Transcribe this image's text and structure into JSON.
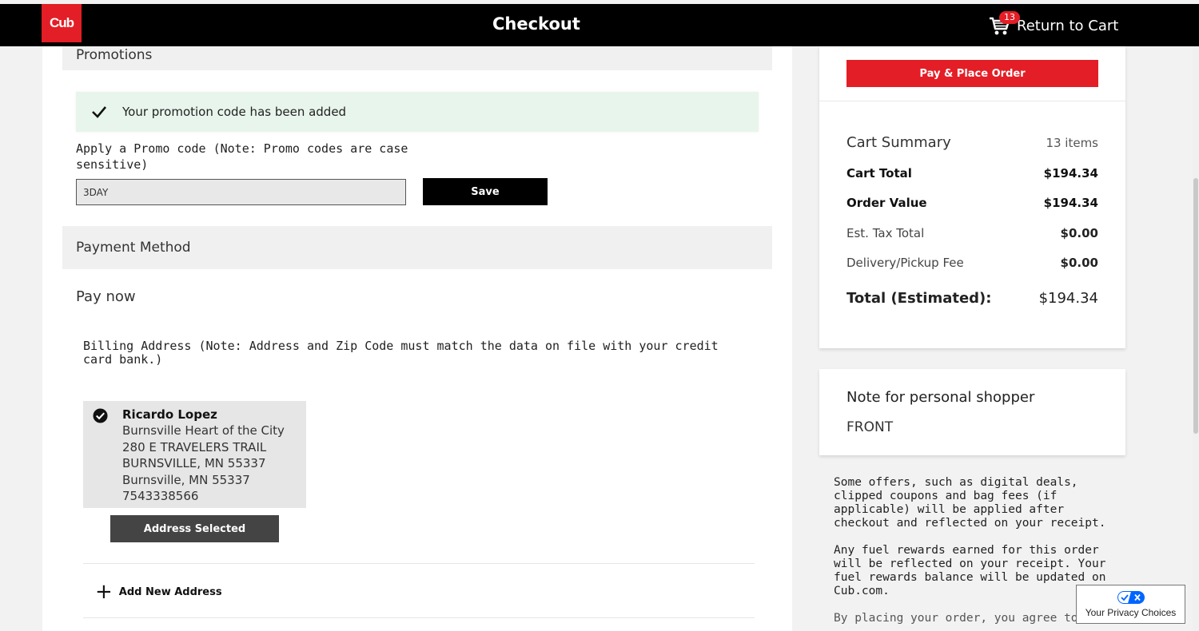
{
  "header": {
    "logo_text": "Cub",
    "title": "Checkout",
    "cart_count": "13",
    "return_label": "Return to Cart"
  },
  "promotions": {
    "heading": "Promotions",
    "success_message": "Your promotion code has been added",
    "label": "Apply a Promo code (Note: Promo codes are case sensitive)",
    "code_value": "3DAY",
    "save_label": "Save"
  },
  "payment": {
    "heading": "Payment Method",
    "pay_now": "Pay now",
    "billing_label": "Billing Address (Note: Address and Zip Code must match the data on file with your credit card bank.)",
    "address": {
      "name": "Ricardo Lopez",
      "line1": "Burnsville Heart of the City",
      "line2": "280 E TRAVELERS TRAIL",
      "line3": "BURNSVILLE, MN 55337",
      "line4": "Burnsville, MN 55337",
      "phone": "7543338566"
    },
    "address_selected_label": "Address Selected",
    "add_address_label": "Add New Address"
  },
  "summary": {
    "place_order_label": "Pay & Place Order",
    "title": "Cart Summary",
    "item_count": "13 items",
    "rows": [
      {
        "label": "Cart Total",
        "value": "$194.34"
      },
      {
        "label": "Order Value",
        "value": "$194.34"
      },
      {
        "label": "Est. Tax Total",
        "value": "$0.00"
      },
      {
        "label": "Delivery/Pickup Fee",
        "value": "$0.00"
      }
    ],
    "total_label": "Total (Estimated):",
    "total_value": "$194.34"
  },
  "note": {
    "title": "Note for personal shopper",
    "value": "FRONT"
  },
  "fine_print": {
    "p1": "Some offers, such as digital deals, clipped coupons and bag fees (if applicable) will be applied after checkout and reflected on your receipt.",
    "p2": "Any fuel rewards earned for this order will be reflected on your receipt. Your fuel rewards balance will be updated on Cub.com.",
    "p3": "By placing your order, you agree to be bound by the Terms of Service and Privacy Policy. In"
  },
  "privacy": {
    "label": "Your Privacy Choices"
  },
  "colors": {
    "brand_red": "#e41e26",
    "header_bg": "#000000",
    "success_bg": "#e8f5ec"
  }
}
